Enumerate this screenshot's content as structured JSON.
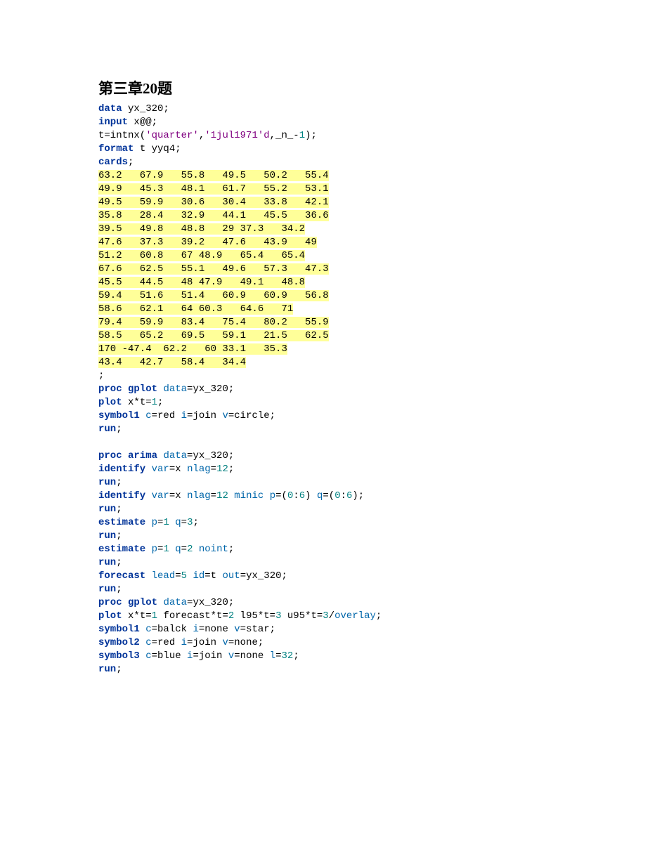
{
  "heading": "第三章20题",
  "tokens": [
    [
      {
        "t": "data ",
        "c": "kw"
      },
      {
        "t": "yx_320;",
        "c": "var"
      }
    ],
    [
      {
        "t": "input ",
        "c": "kw"
      },
      {
        "t": "x@@;",
        "c": "var"
      }
    ],
    [
      {
        "t": "t=intnx(",
        "c": "var"
      },
      {
        "t": "'quarter'",
        "c": "str"
      },
      {
        "t": ",",
        "c": "var"
      },
      {
        "t": "'1jul1971'd",
        "c": "str"
      },
      {
        "t": ",_n_-",
        "c": "var"
      },
      {
        "t": "1",
        "c": "num"
      },
      {
        "t": ");",
        "c": "var"
      }
    ],
    [
      {
        "t": "format ",
        "c": "kw"
      },
      {
        "t": "t yyq4;",
        "c": "var"
      }
    ],
    [
      {
        "t": "cards",
        "c": "kw"
      },
      {
        "t": ";",
        "c": "var"
      }
    ],
    [
      {
        "t": "63.2   67.9   55.8   49.5   50.2   55.4",
        "c": "dat"
      }
    ],
    [
      {
        "t": "49.9   45.3   48.1   61.7   55.2   53.1",
        "c": "dat"
      }
    ],
    [
      {
        "t": "49.5   59.9   30.6   30.4   33.8   42.1",
        "c": "dat"
      }
    ],
    [
      {
        "t": "35.8   28.4   32.9   44.1   45.5   36.6",
        "c": "dat"
      }
    ],
    [
      {
        "t": "39.5   49.8   48.8   29 37.3   34.2",
        "c": "dat"
      }
    ],
    [
      {
        "t": "47.6   37.3   39.2   47.6   43.9   49",
        "c": "dat"
      }
    ],
    [
      {
        "t": "51.2   60.8   67 48.9   65.4   65.4",
        "c": "dat"
      }
    ],
    [
      {
        "t": "67.6   62.5   55.1   49.6   57.3   47.3",
        "c": "dat"
      }
    ],
    [
      {
        "t": "45.5   44.5   48 47.9   49.1   48.8",
        "c": "dat"
      }
    ],
    [
      {
        "t": "59.4   51.6   51.4   60.9   60.9   56.8",
        "c": "dat"
      }
    ],
    [
      {
        "t": "58.6   62.1   64 60.3   64.6   71",
        "c": "dat"
      }
    ],
    [
      {
        "t": "79.4   59.9   83.4   75.4   80.2   55.9",
        "c": "dat"
      }
    ],
    [
      {
        "t": "58.5   65.2   69.5   59.1   21.5   62.5",
        "c": "dat"
      }
    ],
    [
      {
        "t": "170 -47.4  62.2   60 33.1   35.3",
        "c": "dat"
      }
    ],
    [
      {
        "t": "43.4   42.7   58.4   34.4",
        "c": "dat"
      }
    ],
    [
      {
        "t": ";",
        "c": "var"
      }
    ],
    [
      {
        "t": "proc ",
        "c": "kw"
      },
      {
        "t": "gplot ",
        "c": "kw"
      },
      {
        "t": "data",
        "c": "opt"
      },
      {
        "t": "=yx_320;",
        "c": "var"
      }
    ],
    [
      {
        "t": "plot ",
        "c": "kw"
      },
      {
        "t": "x*t=",
        "c": "var"
      },
      {
        "t": "1",
        "c": "num"
      },
      {
        "t": ";",
        "c": "var"
      }
    ],
    [
      {
        "t": "symbol1 ",
        "c": "kw"
      },
      {
        "t": "c",
        "c": "opt"
      },
      {
        "t": "=red ",
        "c": "var"
      },
      {
        "t": "i",
        "c": "opt"
      },
      {
        "t": "=join ",
        "c": "var"
      },
      {
        "t": "v",
        "c": "opt"
      },
      {
        "t": "=circle;",
        "c": "var"
      }
    ],
    [
      {
        "t": "run",
        "c": "kw"
      },
      {
        "t": ";",
        "c": "var"
      }
    ],
    [
      {
        "t": "",
        "c": "var"
      }
    ],
    [
      {
        "t": "proc ",
        "c": "kw"
      },
      {
        "t": "arima ",
        "c": "kw"
      },
      {
        "t": "data",
        "c": "opt"
      },
      {
        "t": "=yx_320;",
        "c": "var"
      }
    ],
    [
      {
        "t": "identify ",
        "c": "kw"
      },
      {
        "t": "var",
        "c": "opt"
      },
      {
        "t": "=x ",
        "c": "var"
      },
      {
        "t": "nlag",
        "c": "opt"
      },
      {
        "t": "=",
        "c": "var"
      },
      {
        "t": "12",
        "c": "num"
      },
      {
        "t": ";",
        "c": "var"
      }
    ],
    [
      {
        "t": "run",
        "c": "kw"
      },
      {
        "t": ";",
        "c": "var"
      }
    ],
    [
      {
        "t": "identify ",
        "c": "kw"
      },
      {
        "t": "var",
        "c": "opt"
      },
      {
        "t": "=x ",
        "c": "var"
      },
      {
        "t": "nlag",
        "c": "opt"
      },
      {
        "t": "=",
        "c": "var"
      },
      {
        "t": "12",
        "c": "num"
      },
      {
        "t": " ",
        "c": "var"
      },
      {
        "t": "minic ",
        "c": "opt"
      },
      {
        "t": "p",
        "c": "opt"
      },
      {
        "t": "=(",
        "c": "var"
      },
      {
        "t": "0",
        "c": "num"
      },
      {
        "t": ":",
        "c": "var"
      },
      {
        "t": "6",
        "c": "num"
      },
      {
        "t": ") ",
        "c": "var"
      },
      {
        "t": "q",
        "c": "opt"
      },
      {
        "t": "=(",
        "c": "var"
      },
      {
        "t": "0",
        "c": "num"
      },
      {
        "t": ":",
        "c": "var"
      },
      {
        "t": "6",
        "c": "num"
      },
      {
        "t": ");",
        "c": "var"
      }
    ],
    [
      {
        "t": "run",
        "c": "kw"
      },
      {
        "t": ";",
        "c": "var"
      }
    ],
    [
      {
        "t": "estimate ",
        "c": "kw"
      },
      {
        "t": "p",
        "c": "opt"
      },
      {
        "t": "=",
        "c": "var"
      },
      {
        "t": "1",
        "c": "num"
      },
      {
        "t": " ",
        "c": "var"
      },
      {
        "t": "q",
        "c": "opt"
      },
      {
        "t": "=",
        "c": "var"
      },
      {
        "t": "3",
        "c": "num"
      },
      {
        "t": ";",
        "c": "var"
      }
    ],
    [
      {
        "t": "run",
        "c": "kw"
      },
      {
        "t": ";",
        "c": "var"
      }
    ],
    [
      {
        "t": "estimate ",
        "c": "kw"
      },
      {
        "t": "p",
        "c": "opt"
      },
      {
        "t": "=",
        "c": "var"
      },
      {
        "t": "1",
        "c": "num"
      },
      {
        "t": " ",
        "c": "var"
      },
      {
        "t": "q",
        "c": "opt"
      },
      {
        "t": "=",
        "c": "var"
      },
      {
        "t": "2",
        "c": "num"
      },
      {
        "t": " ",
        "c": "var"
      },
      {
        "t": "noint",
        "c": "opt"
      },
      {
        "t": ";",
        "c": "var"
      }
    ],
    [
      {
        "t": "run",
        "c": "kw"
      },
      {
        "t": ";",
        "c": "var"
      }
    ],
    [
      {
        "t": "forecast ",
        "c": "kw"
      },
      {
        "t": "lead",
        "c": "opt"
      },
      {
        "t": "=",
        "c": "var"
      },
      {
        "t": "5",
        "c": "num"
      },
      {
        "t": " ",
        "c": "var"
      },
      {
        "t": "id",
        "c": "opt"
      },
      {
        "t": "=t ",
        "c": "var"
      },
      {
        "t": "out",
        "c": "opt"
      },
      {
        "t": "=yx_320;",
        "c": "var"
      }
    ],
    [
      {
        "t": "run",
        "c": "kw"
      },
      {
        "t": ";",
        "c": "var"
      }
    ],
    [
      {
        "t": "proc ",
        "c": "kw"
      },
      {
        "t": "gplot ",
        "c": "kw"
      },
      {
        "t": "data",
        "c": "opt"
      },
      {
        "t": "=yx_320;",
        "c": "var"
      }
    ],
    [
      {
        "t": "plot ",
        "c": "kw"
      },
      {
        "t": "x*t=",
        "c": "var"
      },
      {
        "t": "1",
        "c": "num"
      },
      {
        "t": " forecast*t=",
        "c": "var"
      },
      {
        "t": "2",
        "c": "num"
      },
      {
        "t": " l95*t=",
        "c": "var"
      },
      {
        "t": "3",
        "c": "num"
      },
      {
        "t": " u95*t=",
        "c": "var"
      },
      {
        "t": "3",
        "c": "num"
      },
      {
        "t": "/",
        "c": "var"
      },
      {
        "t": "overlay",
        "c": "opt"
      },
      {
        "t": ";",
        "c": "var"
      }
    ],
    [
      {
        "t": "symbol1 ",
        "c": "kw"
      },
      {
        "t": "c",
        "c": "opt"
      },
      {
        "t": "=balck ",
        "c": "var"
      },
      {
        "t": "i",
        "c": "opt"
      },
      {
        "t": "=none ",
        "c": "var"
      },
      {
        "t": "v",
        "c": "opt"
      },
      {
        "t": "=star;",
        "c": "var"
      }
    ],
    [
      {
        "t": "symbol2 ",
        "c": "kw"
      },
      {
        "t": "c",
        "c": "opt"
      },
      {
        "t": "=red ",
        "c": "var"
      },
      {
        "t": "i",
        "c": "opt"
      },
      {
        "t": "=join ",
        "c": "var"
      },
      {
        "t": "v",
        "c": "opt"
      },
      {
        "t": "=none;",
        "c": "var"
      }
    ],
    [
      {
        "t": "symbol3 ",
        "c": "kw"
      },
      {
        "t": "c",
        "c": "opt"
      },
      {
        "t": "=blue ",
        "c": "var"
      },
      {
        "t": "i",
        "c": "opt"
      },
      {
        "t": "=join ",
        "c": "var"
      },
      {
        "t": "v",
        "c": "opt"
      },
      {
        "t": "=none ",
        "c": "var"
      },
      {
        "t": "l",
        "c": "opt"
      },
      {
        "t": "=",
        "c": "var"
      },
      {
        "t": "32",
        "c": "num"
      },
      {
        "t": ";",
        "c": "var"
      }
    ],
    [
      {
        "t": "run",
        "c": "kw"
      },
      {
        "t": ";",
        "c": "var"
      }
    ]
  ]
}
